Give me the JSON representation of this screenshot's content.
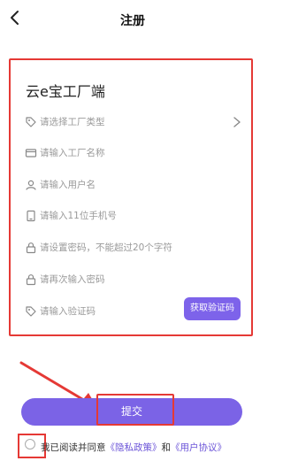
{
  "header": {
    "title": "注册"
  },
  "form": {
    "app_title": "云e宝工厂端",
    "fields": [
      {
        "placeholder": "请选择工厂类型",
        "icon": "tag-icon"
      },
      {
        "placeholder": "请输入工厂名称",
        "icon": "card-icon"
      },
      {
        "placeholder": "请输入用户名",
        "icon": "user-icon"
      },
      {
        "placeholder": "请输入11位手机号",
        "icon": "phone-icon"
      },
      {
        "placeholder": "请设置密码，不能超过20个字符",
        "icon": "lock-icon"
      },
      {
        "placeholder": "请再次输入密码",
        "icon": "lock-icon"
      },
      {
        "placeholder": "请输入验证码",
        "icon": "tag-icon"
      }
    ],
    "get_code_label": "获取验证码"
  },
  "submit": {
    "label": "提交"
  },
  "agreement": {
    "prefix": "我已阅读并同意",
    "privacy": "《隐私政策》",
    "and": "和",
    "terms": "《用户协议》"
  },
  "colors": {
    "accent": "#7b63e6",
    "highlight": "#e53935"
  }
}
